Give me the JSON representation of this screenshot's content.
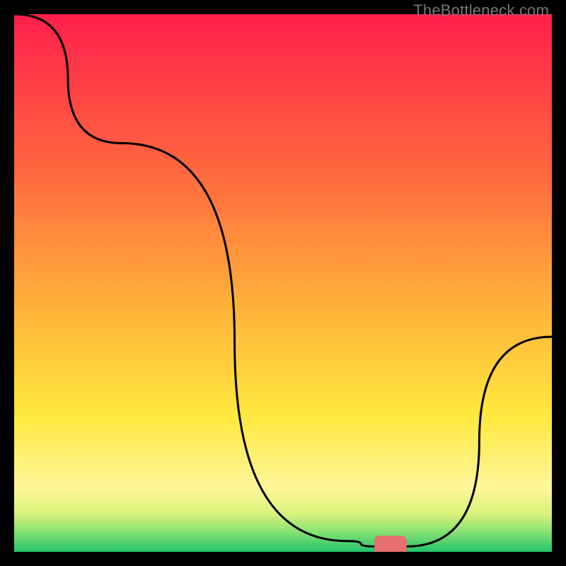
{
  "watermark": "TheBottleneck.com",
  "chart_data": {
    "type": "line",
    "title": "",
    "xlabel": "",
    "ylabel": "",
    "xlim": [
      0,
      100
    ],
    "ylim": [
      0,
      100
    ],
    "x": [
      0,
      20,
      62,
      67,
      73,
      100
    ],
    "values": [
      100,
      76,
      2,
      1,
      1,
      40
    ],
    "marker": {
      "x": 70,
      "y": 1,
      "color": "#e76f6f",
      "width": 6,
      "height": 2
    },
    "background_gradient": {
      "stops": [
        {
          "pos": 0.0,
          "color": "#ff1f4b"
        },
        {
          "pos": 0.3,
          "color": "#ff6a3f"
        },
        {
          "pos": 0.55,
          "color": "#ffb43a"
        },
        {
          "pos": 0.75,
          "color": "#ffe93f"
        },
        {
          "pos": 0.88,
          "color": "#fff69a"
        },
        {
          "pos": 0.93,
          "color": "#d9f27a"
        },
        {
          "pos": 0.96,
          "color": "#8ee374"
        },
        {
          "pos": 1.0,
          "color": "#23c36a"
        }
      ]
    }
  }
}
